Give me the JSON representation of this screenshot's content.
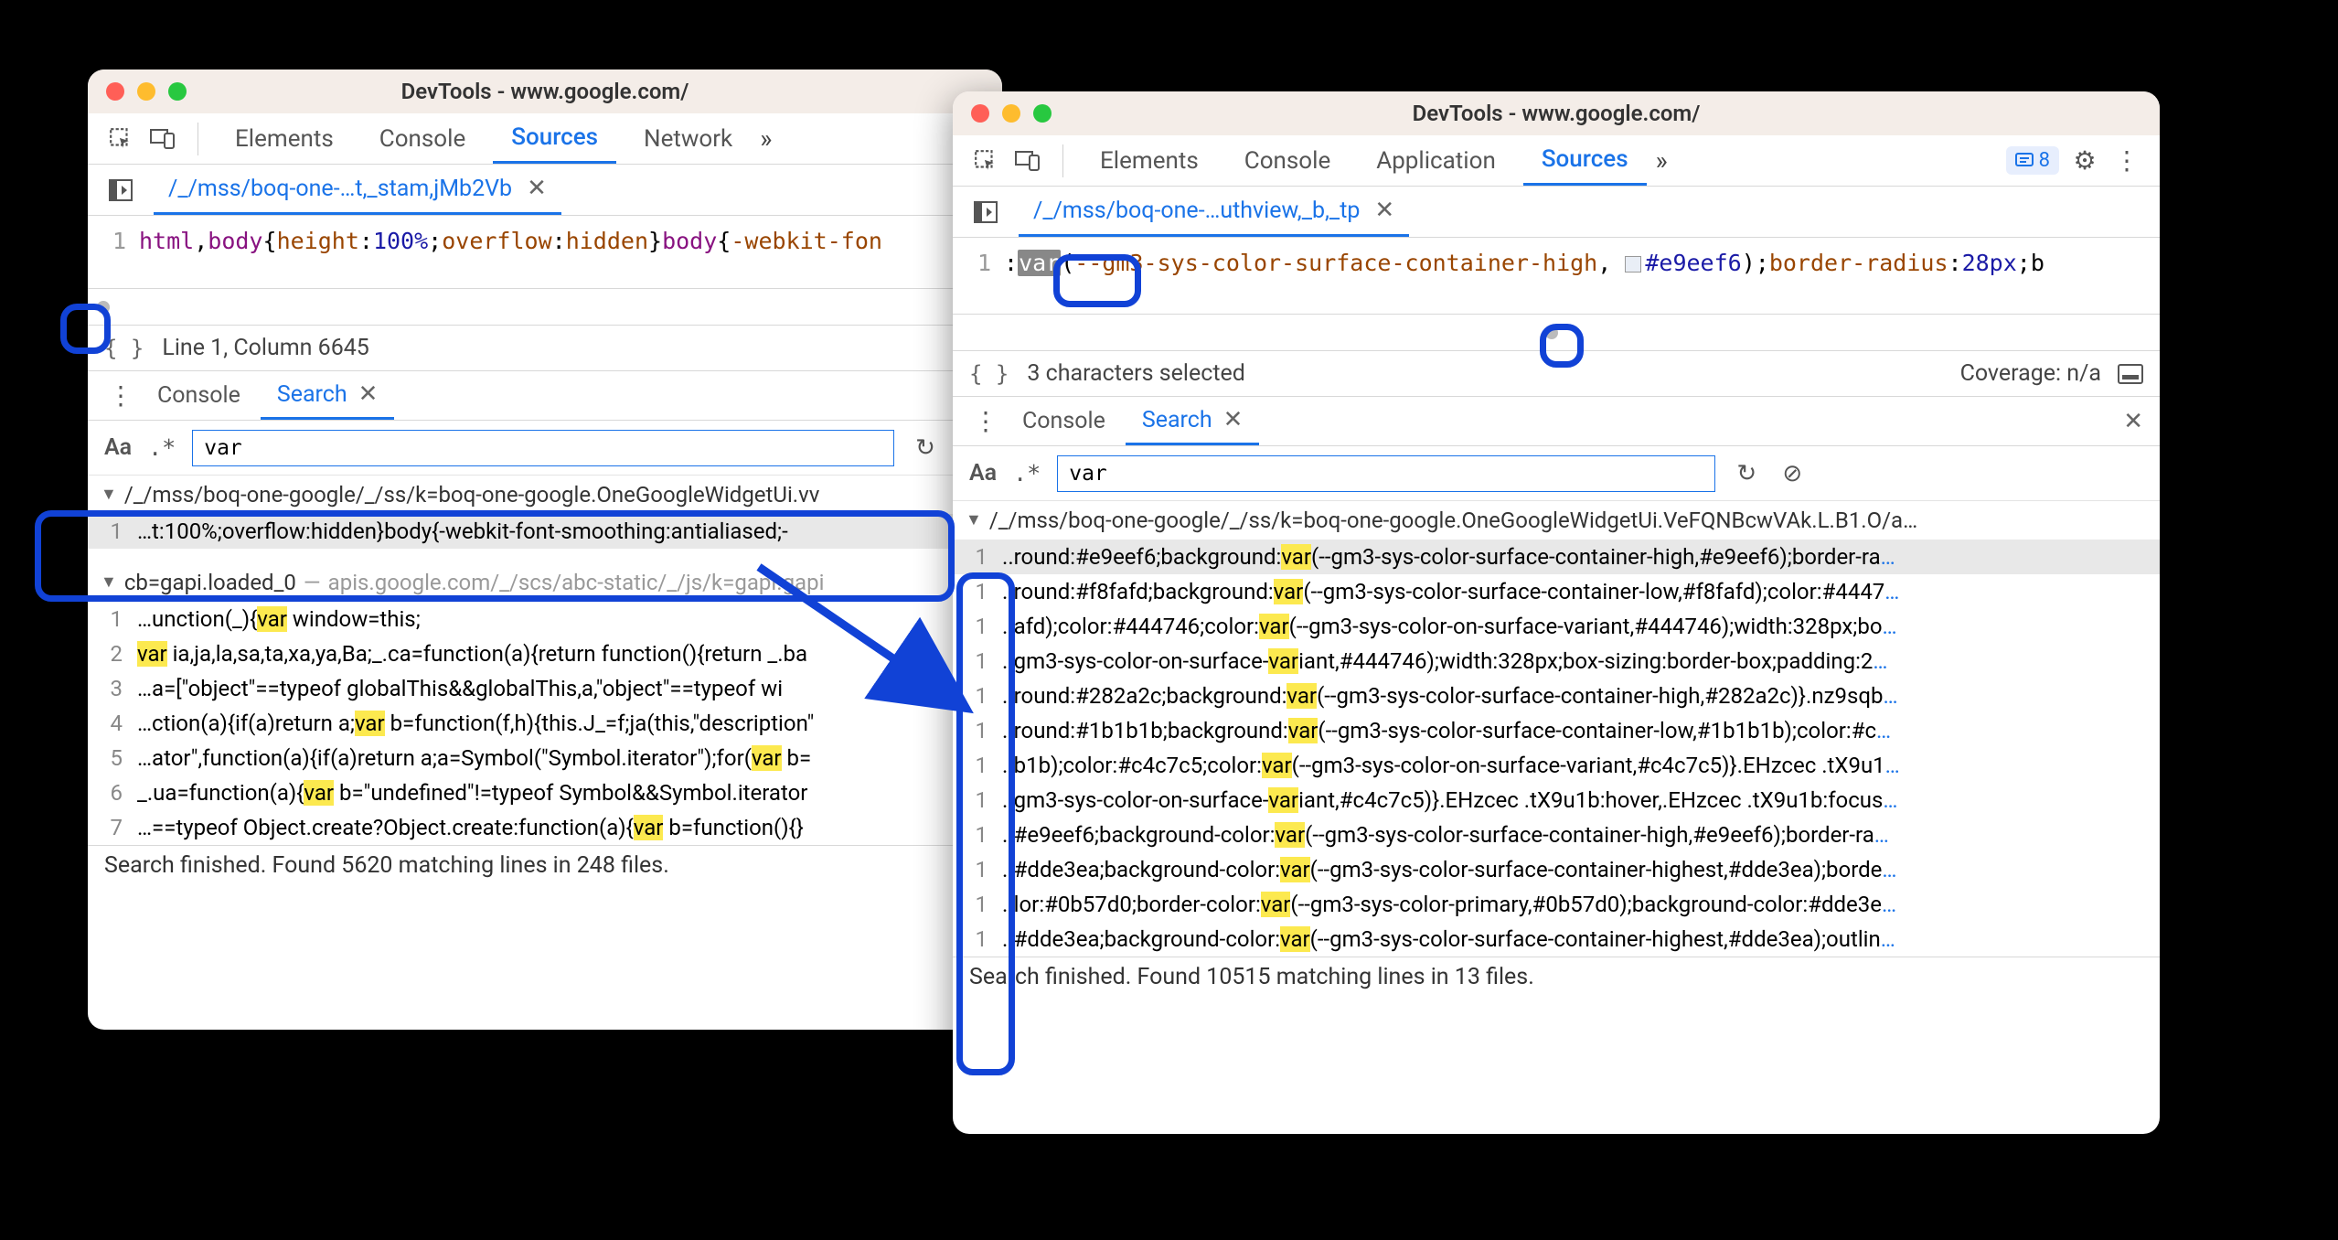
{
  "left": {
    "title": "DevTools - www.google.com/",
    "tabs": {
      "elements": "Elements",
      "console": "Console",
      "sources": "Sources",
      "network": "Network"
    },
    "file_tab": "/_/mss/boq-one-…t,_stam,jMb2Vb",
    "gutter_line": "1",
    "code_html": "html",
    "code_body": "body",
    "code_brace_open": "{",
    "code_height": "height",
    "code_100": "100%",
    "code_overflow": "overflow",
    "code_hidden": "hidden",
    "code_brace_close": "}",
    "code_webkit_prefix": "-webkit-fon",
    "status": "Line 1, Column 6645",
    "drawer_console": "Console",
    "drawer_search": "Search",
    "aa": "Aa",
    "regex": ".*",
    "search_value": "var",
    "file1": "/_/mss/boq-one-google/_/ss/k=boq-one-google.OneGoogleWidgetUi.vv",
    "f1_r1_num": "1",
    "f1_r1": "…t:100%;overflow:hidden}body{-webkit-font-smoothing:antialiased;-",
    "file2_name": "cb=gapi.loaded_0",
    "file2_path": "apis.google.com/_/scs/abc-static/_/js/k=gapi.gapi",
    "rows2": [
      {
        "num": "1",
        "pre": "…unction(_){",
        "hl": "var",
        "post": " window=this;"
      },
      {
        "num": "2",
        "pre": "",
        "hl": "var",
        "post": " ia,ja,la,sa,ta,xa,ya,Ba;_.ca=function(a){return function(){return _.ba"
      },
      {
        "num": "3",
        "pre": "…a=[\"object\"==typeof globalThis&&globalThis,a,\"object\"==typeof wi",
        "hl": "",
        "post": ""
      },
      {
        "num": "4",
        "pre": "…ction(a){if(a)return a;",
        "hl": "var",
        "post": " b=function(f,h){this.J_=f;ja(this,\"description\""
      },
      {
        "num": "5",
        "pre": "…ator\",function(a){if(a)return a;a=Symbol(\"Symbol.iterator\");for(",
        "hl": "var",
        "post": " b="
      },
      {
        "num": "6",
        "pre": "_.ua=function(a){",
        "hl": "var",
        "post": " b=\"undefined\"!=typeof Symbol&&Symbol.iterator"
      },
      {
        "num": "7",
        "pre": "…==typeof Object.create?Object.create:function(a){",
        "hl": "var",
        "post": " b=function(){}"
      }
    ],
    "footer": "Search finished.  Found 5620 matching lines in 248 files."
  },
  "right": {
    "title": "DevTools - www.google.com/",
    "tabs": {
      "elements": "Elements",
      "console": "Console",
      "application": "Application",
      "sources": "Sources"
    },
    "msg_count": "8",
    "file_tab": "/_/mss/boq-one-…uthview,_b,_tp",
    "gutter_line": "1",
    "code_colon": ":",
    "code_var": "var",
    "code_open_paren": "(",
    "code_cssvar": "--gm3-sys-color-surface-container-high",
    "code_comma": ", ",
    "code_hex": "#e9eef6",
    "code_close_paren": ")",
    "code_semicolon": ";",
    "code_border": "border-radius",
    "code_radius": "28px",
    "code_b_suffix": ";b",
    "status": "3 characters selected",
    "coverage": "Coverage: n/a",
    "drawer_console": "Console",
    "drawer_search": "Search",
    "aa": "Aa",
    "regex": ".*",
    "search_value": "var",
    "file1": "/_/mss/boq-one-google/_/ss/k=boq-one-google.OneGoogleWidgetUi.VeFQNBcwVAk.L.B1.O/a…",
    "rows": [
      {
        "num": "1",
        "pre": "..round:#e9eef6;background:",
        "hl": "var",
        "post": "(--gm3-sys-color-surface-container-high,#e9eef6);border-ra",
        "sel": true
      },
      {
        "num": "1",
        "pre": "..round:#f8fafd;background:",
        "hl": "var",
        "post": "(--gm3-sys-color-surface-container-low,#f8fafd);color:#4447"
      },
      {
        "num": "1",
        "pre": "..afd);color:#444746;color:",
        "hl": "var",
        "post": "(--gm3-sys-color-on-surface-variant,#444746);width:328px;bo"
      },
      {
        "num": "1",
        "pre": "..gm3-sys-color-on-surface-",
        "hl": "var",
        "post2": "iant,#444746);width:328px;box-sizing:border-box;padding:2"
      },
      {
        "num": "1",
        "pre": "..round:#282a2c;background:",
        "hl": "var",
        "post": "(--gm3-sys-color-surface-container-high,#282a2c)}.nz9sqb"
      },
      {
        "num": "1",
        "pre": "..round:#1b1b1b;background:",
        "hl": "var",
        "post": "(--gm3-sys-color-surface-container-low,#1b1b1b);color:#c"
      },
      {
        "num": "1",
        "pre": "..b1b);color:#c4c7c5;color:",
        "hl": "var",
        "post": "(--gm3-sys-color-on-surface-variant,#c4c7c5)}.EHzcec .tX9u1"
      },
      {
        "num": "1",
        "pre": "..gm3-sys-color-on-surface-",
        "hl": "var",
        "post2": "iant,#c4c7c5)}.EHzcec .tX9u1b:hover,.EHzcec .tX9u1b:focus"
      },
      {
        "num": "1",
        "pre": "..#e9eef6;background-color:",
        "hl": "var",
        "post": "(--gm3-sys-color-surface-container-high,#e9eef6);border-ra"
      },
      {
        "num": "1",
        "pre": "..#dde3ea;background-color:",
        "hl": "var",
        "post": "(--gm3-sys-color-surface-container-highest,#dde3ea);borde"
      },
      {
        "num": "1",
        "pre": "..lor:#0b57d0;border-color:",
        "hl": "var",
        "post": "(--gm3-sys-color-primary,#0b57d0);background-color:#dde3e"
      },
      {
        "num": "1",
        "pre": "..#dde3ea;background-color:",
        "hl": "var",
        "post": "(--gm3-sys-color-surface-container-highest,#dde3ea);outlin"
      }
    ],
    "footer": "Search finished.  Found 10515 matching lines in 13 files."
  }
}
